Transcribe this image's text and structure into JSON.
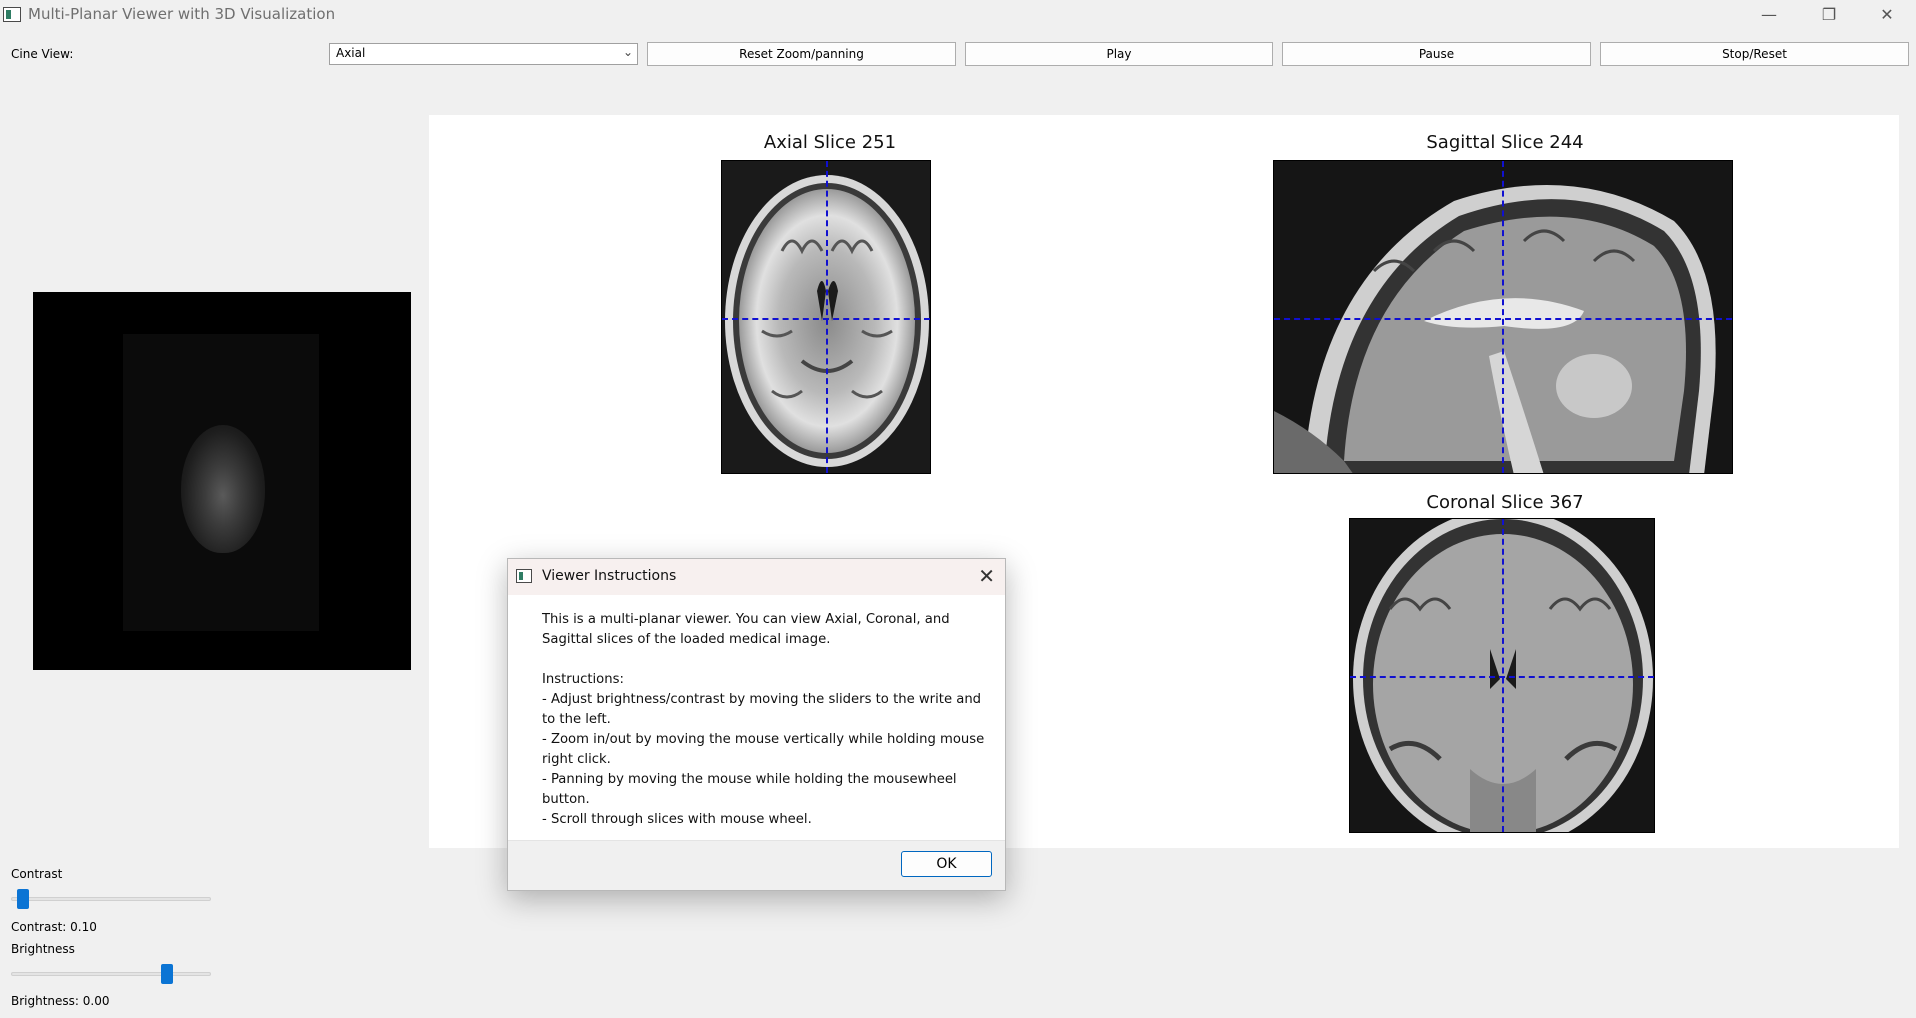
{
  "window": {
    "title": "Multi-Planar Viewer with 3D Visualization",
    "minimize_glyph": "—",
    "restore_glyph": "❐",
    "close_glyph": "✕"
  },
  "toolbar": {
    "cine_label": "Cine View:",
    "cine_selected": "Axial",
    "combo_arrow": "⌄",
    "reset_label": "Reset Zoom/panning",
    "play_label": "Play",
    "pause_label": "Pause",
    "stop_label": "Stop/Reset"
  },
  "controls": {
    "contrast_label": "Contrast",
    "contrast_value_text": "Contrast: 0.10",
    "contrast_level": 0.03,
    "brightness_label": "Brightness",
    "brightness_value_text": "Brightness: 0.00",
    "brightness_level": 0.8
  },
  "views": {
    "axial_title": "Axial Slice 251",
    "sagittal_title": "Sagittal Slice 244",
    "coronal_title": "Coronal Slice 367"
  },
  "dialog": {
    "title": "Viewer Instructions",
    "close_glyph": "✕",
    "intro": "This is a multi-planar viewer. You can view Axial, Coronal, and Sagittal slices of the loaded medical image.",
    "instructions_header": "Instructions:",
    "instructions": [
      "- Adjust brightness/contrast by moving the sliders to the write and to the left.",
      "- Zoom in/out by moving the mouse vertically while holding mouse right click.",
      "- Panning by moving the mouse while holding the mousewheel button.",
      "- Scroll through slices with mouse wheel."
    ],
    "ok_label": "OK"
  },
  "colors": {
    "crosshair": "#1010d0",
    "slider_handle": "#0b74d4",
    "ok_border": "#0067c0"
  }
}
